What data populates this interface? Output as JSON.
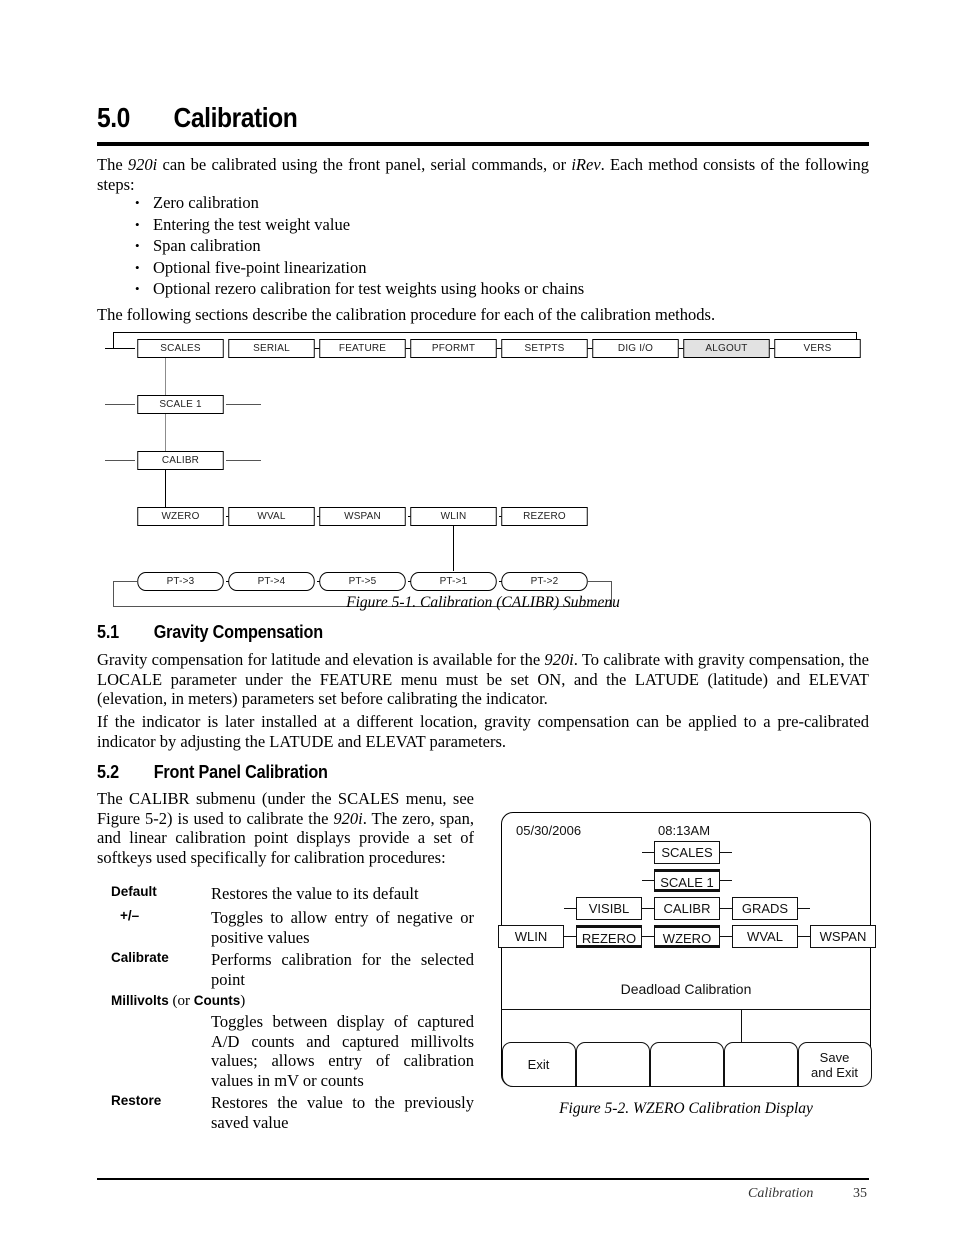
{
  "section_main": {
    "number": "5.0",
    "title": "Calibration"
  },
  "intro": {
    "line1_a": "The ",
    "line1_i1": "920i",
    "line1_b": " can be calibrated using the front panel, serial commands, or ",
    "line1_i2": "iRev",
    "line1_c": ". Each method consists of the following steps:",
    "bullets": [
      "Zero calibration",
      "Entering the test weight value",
      "Span calibration",
      "Optional five-point linearization",
      "Optional rezero calibration for test weights using hooks or chains"
    ],
    "closing": "The following sections describe the calibration procedure for each of the calibration methods."
  },
  "figure1": {
    "caption": "Figure 5-1. Calibration (CALIBR) Submenu",
    "row_main": [
      "SCALES",
      "SERIAL",
      "FEATURE",
      "PFORMT",
      "SETPTS",
      "DIG I/O",
      "ALGOUT",
      "VERS"
    ],
    "highlighted": "ALGOUT",
    "row_scale": "SCALE 1",
    "row_calibr": "CALIBR",
    "row_calibr_children": [
      "WZERO",
      "WVAL",
      "WSPAN",
      "WLIN",
      "REZERO"
    ],
    "row_points": [
      "PT->3",
      "PT->4",
      "PT->5",
      "PT->1",
      "PT->2"
    ]
  },
  "section_gravity": {
    "number": "5.1",
    "title": "Gravity Compensation",
    "para1_a": "Gravity compensation for latitude and elevation is available for the ",
    "para1_i": "920i",
    "para1_b": ". To calibrate with gravity compensation, the LOCALE parameter under the FEATURE menu must be set ON, and the LATUDE (latitude) and ELEVAT (elevation, in meters) parameters set before calibrating the indicator.",
    "para2": "If the indicator is later installed at a different location, gravity compensation can be applied to a pre-calibrated indicator by adjusting the LATUDE and ELEVAT parameters."
  },
  "section_front_panel": {
    "number": "5.2",
    "title": "Front Panel Calibration",
    "para_a": "The CALIBR submenu (under the SCALES menu, see Figure 5-2) is used to calibrate the ",
    "para_i": "920i",
    "para_b": ". The zero, span, and linear calibration point displays provide a set of softkeys used specifically for calibration procedures:",
    "definitions": [
      {
        "term": "Default",
        "desc": "Restores the value to its default"
      },
      {
        "term": "+/–",
        "desc": "Toggles to allow entry of negative or positive values"
      },
      {
        "term": "Calibrate",
        "desc": "Performs calibration for the selected point"
      },
      {
        "term": "Millivolts",
        "term_paren_open": " (or ",
        "term_bold2": "Counts",
        "term_paren_close": ")",
        "desc": "Toggles between display of captured A/D counts and captured millivolts values; allows entry of calibration values in mV or counts"
      },
      {
        "term": "Restore",
        "desc": "Restores the value to the previously saved value"
      }
    ]
  },
  "figure2": {
    "caption": "Figure 5-2. WZERO Calibration Display",
    "date": "05/30/2006",
    "time": "08:13AM",
    "menu_row1": "SCALES",
    "menu_row2": "SCALE 1",
    "menu_row3": [
      "VISIBL",
      "CALIBR",
      "GRADS"
    ],
    "menu_row4": [
      "WLIN",
      "REZERO",
      "WZERO",
      "WVAL",
      "WSPAN"
    ],
    "status_label": "Deadload Calibration",
    "softkeys": [
      "Exit",
      "",
      "",
      "",
      "Save\nand Exit"
    ],
    "softkey_save_line1": "Save",
    "softkey_save_line2": "and Exit"
  },
  "footer": {
    "section": "Calibration",
    "page": "35"
  }
}
